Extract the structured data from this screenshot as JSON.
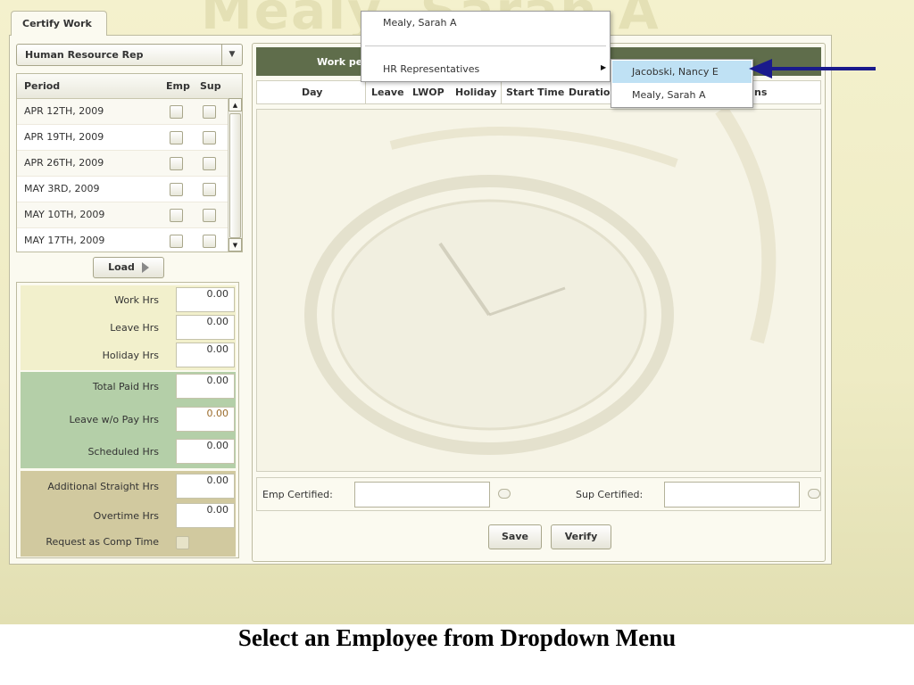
{
  "watermark_name": "Mealy, Sarah A",
  "tab": {
    "label": "Certify Work"
  },
  "role_select": {
    "value": "Human Resource Rep"
  },
  "period_table": {
    "headers": {
      "period": "Period",
      "emp": "Emp",
      "sup": "Sup"
    },
    "rows": [
      {
        "date": "APR 12TH, 2009",
        "emp": false,
        "sup": false
      },
      {
        "date": "APR 19TH, 2009",
        "emp": false,
        "sup": false
      },
      {
        "date": "APR 26TH, 2009",
        "emp": false,
        "sup": false
      },
      {
        "date": "MAY 3RD, 2009",
        "emp": false,
        "sup": false
      },
      {
        "date": "MAY 10TH, 2009",
        "emp": false,
        "sup": false
      },
      {
        "date": "MAY 17TH, 2009",
        "emp": false,
        "sup": false
      }
    ]
  },
  "load_button": {
    "label": "Load"
  },
  "hours": {
    "work": {
      "label": "Work Hrs",
      "value": "0.00"
    },
    "leave": {
      "label": "Leave Hrs",
      "value": "0.00"
    },
    "holiday": {
      "label": "Holiday Hrs",
      "value": "0.00"
    },
    "total_paid": {
      "label": "Total Paid Hrs",
      "value": "0.00"
    },
    "lwop": {
      "label": "Leave w/o Pay Hrs",
      "value": "0.00"
    },
    "scheduled": {
      "label": "Scheduled Hrs",
      "value": "0.00"
    },
    "additional_straight": {
      "label": "Additional Straight Hrs",
      "value": "0.00"
    },
    "overtime": {
      "label": "Overtime Hrs",
      "value": "0.00"
    },
    "comp_time": {
      "label": "Request as Comp Time",
      "checked": false
    }
  },
  "work_panel": {
    "title_visible": "Work pe",
    "columns": {
      "day": "Day",
      "leave": "Leave",
      "lwop": "LWOP",
      "holiday": "Holiday",
      "start_time": "Start Time",
      "duration": "Duration",
      "trailing": "ns"
    }
  },
  "certify": {
    "emp_label": "Emp Certified:",
    "sup_label": "Sup Certified:",
    "emp_value": "",
    "sup_value": ""
  },
  "buttons": {
    "save": "Save",
    "verify": "Verify"
  },
  "employee_menu": {
    "current": "Mealy, Sarah A",
    "group": "HR Representatives",
    "submenu": [
      "Jacobski, Nancy E",
      "Mealy, Sarah A"
    ],
    "highlighted_index": 0
  },
  "caption": "Select an Employee from Dropdown Menu",
  "colors": {
    "background": "#f1eec8",
    "panel": "#fbfaf0",
    "header_bar": "#5f6d4b",
    "section_green": "#b4cfa8",
    "section_tan": "#d1c99f",
    "section_cream": "#f2f0cc",
    "menu_highlight": "#bfe1f4",
    "annotation_arrow": "#1a1a8c"
  }
}
